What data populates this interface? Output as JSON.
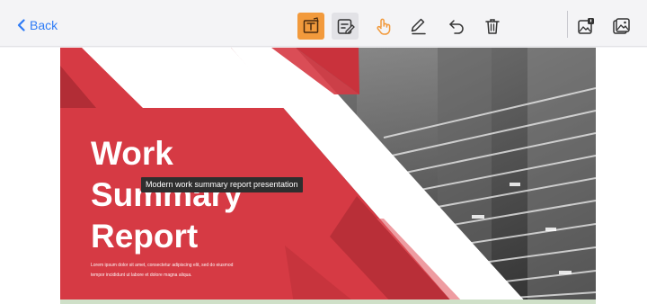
{
  "nav": {
    "back_label": "Back"
  },
  "toolbar": {
    "tools": [
      {
        "name": "select-text-tool",
        "icon": "text-select-icon",
        "state": "active"
      },
      {
        "name": "annotate-tool",
        "icon": "edit-note-icon",
        "state": "selected"
      },
      {
        "name": "touch-tool",
        "icon": "hand-touch-icon",
        "state": "normal"
      },
      {
        "name": "pen-tool",
        "icon": "pen-icon",
        "state": "normal"
      },
      {
        "name": "undo-tool",
        "icon": "undo-icon",
        "state": "normal"
      },
      {
        "name": "delete-tool",
        "icon": "trash-icon",
        "state": "normal"
      },
      {
        "name": "image-edit-tool",
        "icon": "image-badge-icon",
        "state": "normal"
      },
      {
        "name": "image-tool",
        "icon": "image-icon",
        "state": "normal"
      }
    ],
    "accent": "#f29a3c",
    "link_color": "#2f7cf6"
  },
  "slide": {
    "title_lines": [
      "Work",
      "Summary",
      "Report"
    ],
    "body_lines": [
      "Lorem ipsum dolor sit amet, consectetur adipiscing elit, sed do eiusmod",
      "tempor incididunt ut labore et dolore magna aliqua."
    ],
    "brand_color": "#d63a44"
  },
  "tooltip": {
    "text": "Modern work summary report presentation"
  }
}
